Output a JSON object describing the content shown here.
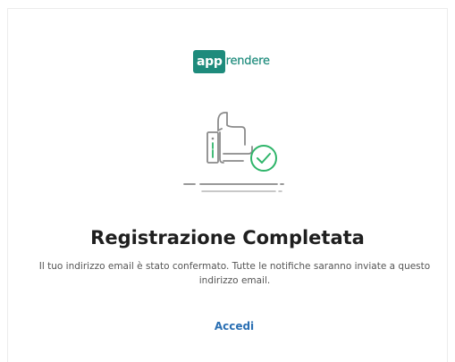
{
  "logo": {
    "badge_text": "app",
    "word_text": "rendere",
    "brand_color": "#1e8b7c"
  },
  "illustration": {
    "icon": "thumbs-up-with-check-icon",
    "line_color": "#8a8a8a",
    "check_color": "#2fb56a"
  },
  "title": "Registrazione Completata",
  "message": "Il tuo indirizzo email è stato confermato. Tutte le notifiche saranno inviate a questo indirizzo email.",
  "login_link": {
    "label": "Accedi",
    "color": "#2a6fb3"
  }
}
